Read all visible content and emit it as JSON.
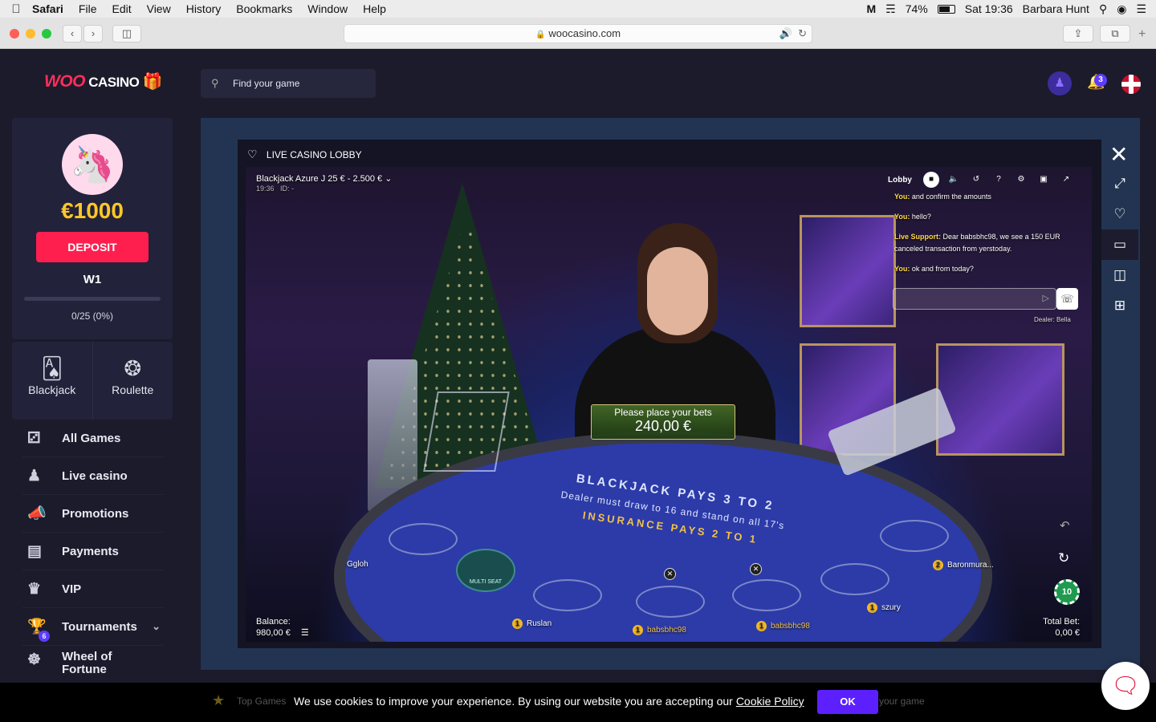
{
  "menubar": {
    "app": "Safari",
    "items": [
      "File",
      "Edit",
      "View",
      "History",
      "Bookmarks",
      "Window",
      "Help"
    ],
    "battery": "74%",
    "clock": "Sat 19:36",
    "user": "Barbara Hunt"
  },
  "browser": {
    "url": "woocasino.com"
  },
  "sidebar": {
    "logo_primary": "WOO",
    "logo_secondary": "CASINO",
    "balance": "€1000",
    "deposit_label": "DEPOSIT",
    "level": "W1",
    "progress_text": "0/25 (0%)",
    "progress_fraction": 0,
    "quick": [
      {
        "label": "Blackjack",
        "icon": "cards-icon"
      },
      {
        "label": "Roulette",
        "icon": "roulette-icon"
      }
    ],
    "nav": [
      {
        "label": "All Games",
        "icon": "dice-icon"
      },
      {
        "label": "Live casino",
        "icon": "person-icon"
      },
      {
        "label": "Promotions",
        "icon": "megaphone-icon"
      },
      {
        "label": "Payments",
        "icon": "wallet-icon"
      },
      {
        "label": "VIP",
        "icon": "crown-icon"
      },
      {
        "label": "Tournaments",
        "icon": "trophy-icon",
        "badge": "6"
      },
      {
        "label": "Wheel of Fortune",
        "icon": "wheel-icon"
      }
    ]
  },
  "topbar": {
    "search_placeholder": "Find your game",
    "notifications": "3"
  },
  "game": {
    "frame_title": "LIVE CASINO LOBBY",
    "table_title": "Blackjack Azure J 25 € - 2.500 €",
    "table_time": "19:36",
    "table_id": "ID: -",
    "lobby_label": "Lobby",
    "chat": [
      {
        "who": "You:",
        "text": "and confirm the amounts"
      },
      {
        "who": "You:",
        "text": "hello?"
      },
      {
        "who": "Live Support:",
        "text": "Dear babsbhc98, we see a 150 EUR canceled transaction from yerstoday."
      },
      {
        "who": "You:",
        "text": "ok and from today?"
      }
    ],
    "dealer": "Dealer: Bella",
    "bet_prompt": "Please place your bets",
    "bet_amount": "240,00 €",
    "table_line1": "BLACKJACK PAYS 3 TO 2",
    "table_line2": "Dealer must draw to 16 and stand on all 17's",
    "table_line3": "INSURANCE PAYS 2 TO 1",
    "multi_seat": "MULTI SEAT",
    "players": [
      {
        "name": "Ggloh"
      },
      {
        "name": "Ruslan",
        "num": "1"
      },
      {
        "name": "babsbhc98",
        "num": "1"
      },
      {
        "name": "babsbhc98",
        "num": "1"
      },
      {
        "name": "szury",
        "num": "1"
      },
      {
        "name": "Baronmura...",
        "num": "2"
      }
    ],
    "chip": "10",
    "balance_label": "Balance:",
    "balance_value": "980,00 €",
    "total_bet_label": "Total Bet:",
    "total_bet_value": "0,00 €"
  },
  "cookie": {
    "message": "We use cookies to improve your experience. By using our website you are accepting our",
    "policy_link": "Cookie Policy",
    "ok": "OK",
    "behind_left": "Top Games",
    "behind_right": "your game"
  }
}
